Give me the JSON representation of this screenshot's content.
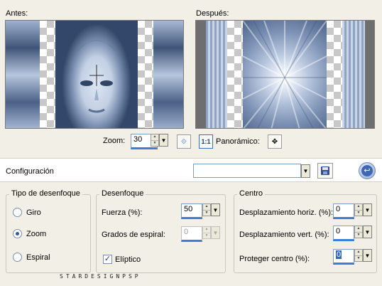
{
  "preview": {
    "before_label": "Antes:",
    "after_label": "Después:"
  },
  "zoom": {
    "label": "Zoom:",
    "value": "30",
    "actual_size_label": "1:1",
    "panoramic_label": "Panorámico:"
  },
  "settings": {
    "label": "Configuración",
    "value": ""
  },
  "blur_type": {
    "title": "Tipo de desenfoque",
    "options": [
      "Giro",
      "Zoom",
      "Espiral"
    ],
    "selected": "Zoom"
  },
  "blur": {
    "title": "Desenfoque",
    "strength_label": "Fuerza (%):",
    "strength_value": "50",
    "spiral_label": "Grados de espiral:",
    "spiral_value": "0",
    "elliptic_label": "Elíptico",
    "elliptic_checked": true
  },
  "center": {
    "title": "Centro",
    "h_offset_label": "Desplazamiento horiz. (%):",
    "h_offset_value": "0",
    "v_offset_label": "Desplazamiento vert. (%):",
    "v_offset_value": "0",
    "protect_label": "Proteger centro (%):",
    "protect_value": "0"
  },
  "watermark": "STARDESIGNPSP",
  "colors": {
    "accent": "#3b7fd6",
    "dialog_bg": "#f1efe6"
  }
}
